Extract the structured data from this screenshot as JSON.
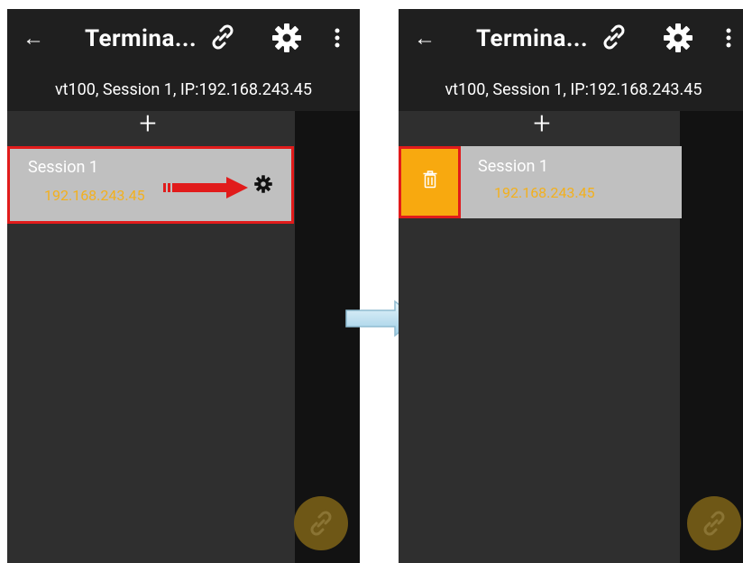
{
  "left_screen": {
    "appbar": {
      "back_icon": "←",
      "title": "Termina...",
      "link_icon": "🔗",
      "gear_icon": "⚙",
      "more_icon": "⋮"
    },
    "subtitle": "vt100, Session 1, IP:192.168.243.45",
    "add_button": "+",
    "session": {
      "name": "Session 1",
      "ip": "192.168.243.45"
    },
    "fab_icon": "🔗"
  },
  "right_screen": {
    "appbar": {
      "back_icon": "←",
      "title": "Termina...",
      "link_icon": "🔗",
      "gear_icon": "⚙",
      "more_icon": "⋮"
    },
    "subtitle": "vt100, Session 1, IP:192.168.243.45",
    "add_button": "+",
    "session": {
      "name": "Session 1",
      "ip": "192.168.243.45"
    },
    "fab_icon": "🔗"
  },
  "colors": {
    "appbar": "#1f1f1f",
    "content": "#2f2f2f",
    "card": "#c0c0c0",
    "ip_text": "#f2b01e",
    "highlight": "#e11b1b",
    "delete": "#f8a90f",
    "fab": "#6e5716"
  }
}
